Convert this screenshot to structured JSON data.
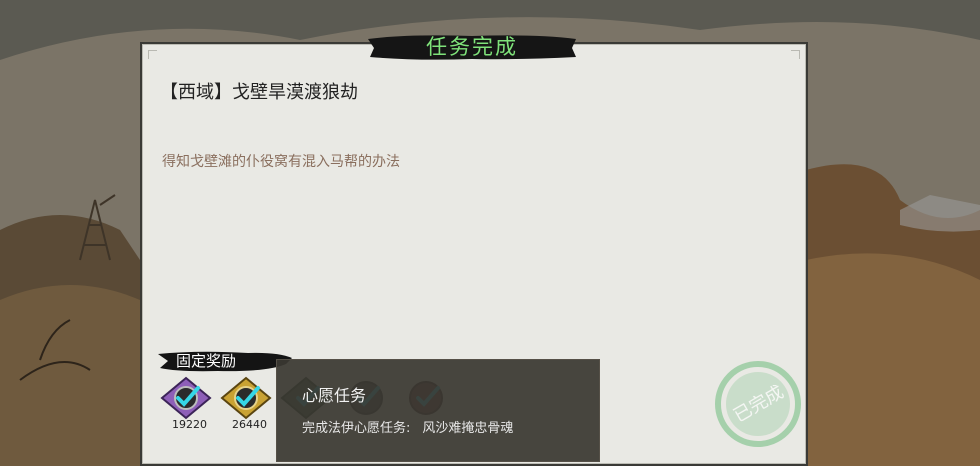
{
  "dialog": {
    "title": "任务完成",
    "quest_name": "【西域】戈壁旱漠渡狼劫",
    "quest_description": "得知戈壁滩的仆役窝有混入马帮的办法",
    "stamp_text": "已完成"
  },
  "rewards": {
    "section_label": "固定奖励",
    "items": [
      {
        "icon": "purple-rune-item-icon",
        "count": "19220",
        "claimed": true,
        "color": "#8e5fb8"
      },
      {
        "icon": "gold-rune-item-icon",
        "count": "26440",
        "claimed": true,
        "color": "#c9a233"
      },
      {
        "icon": "green-rune-item-icon",
        "count": "",
        "claimed": true,
        "color": "#4d6a4a"
      },
      {
        "icon": "dark-rune-item-icon",
        "count": "",
        "claimed": true,
        "color": "#4a4a4a"
      },
      {
        "icon": "red-rune-item-icon",
        "count": "",
        "claimed": true,
        "color": "#6e3b3b"
      }
    ]
  },
  "tooltip": {
    "title": "心愿任务",
    "body_prefix": "完成法伊心愿任务:",
    "body_quest": "风沙难掩忠骨魂"
  },
  "colors": {
    "title_green": "#7fe27a",
    "check_cyan": "#35d6e6",
    "stamp_green": "#6dbb7c"
  }
}
